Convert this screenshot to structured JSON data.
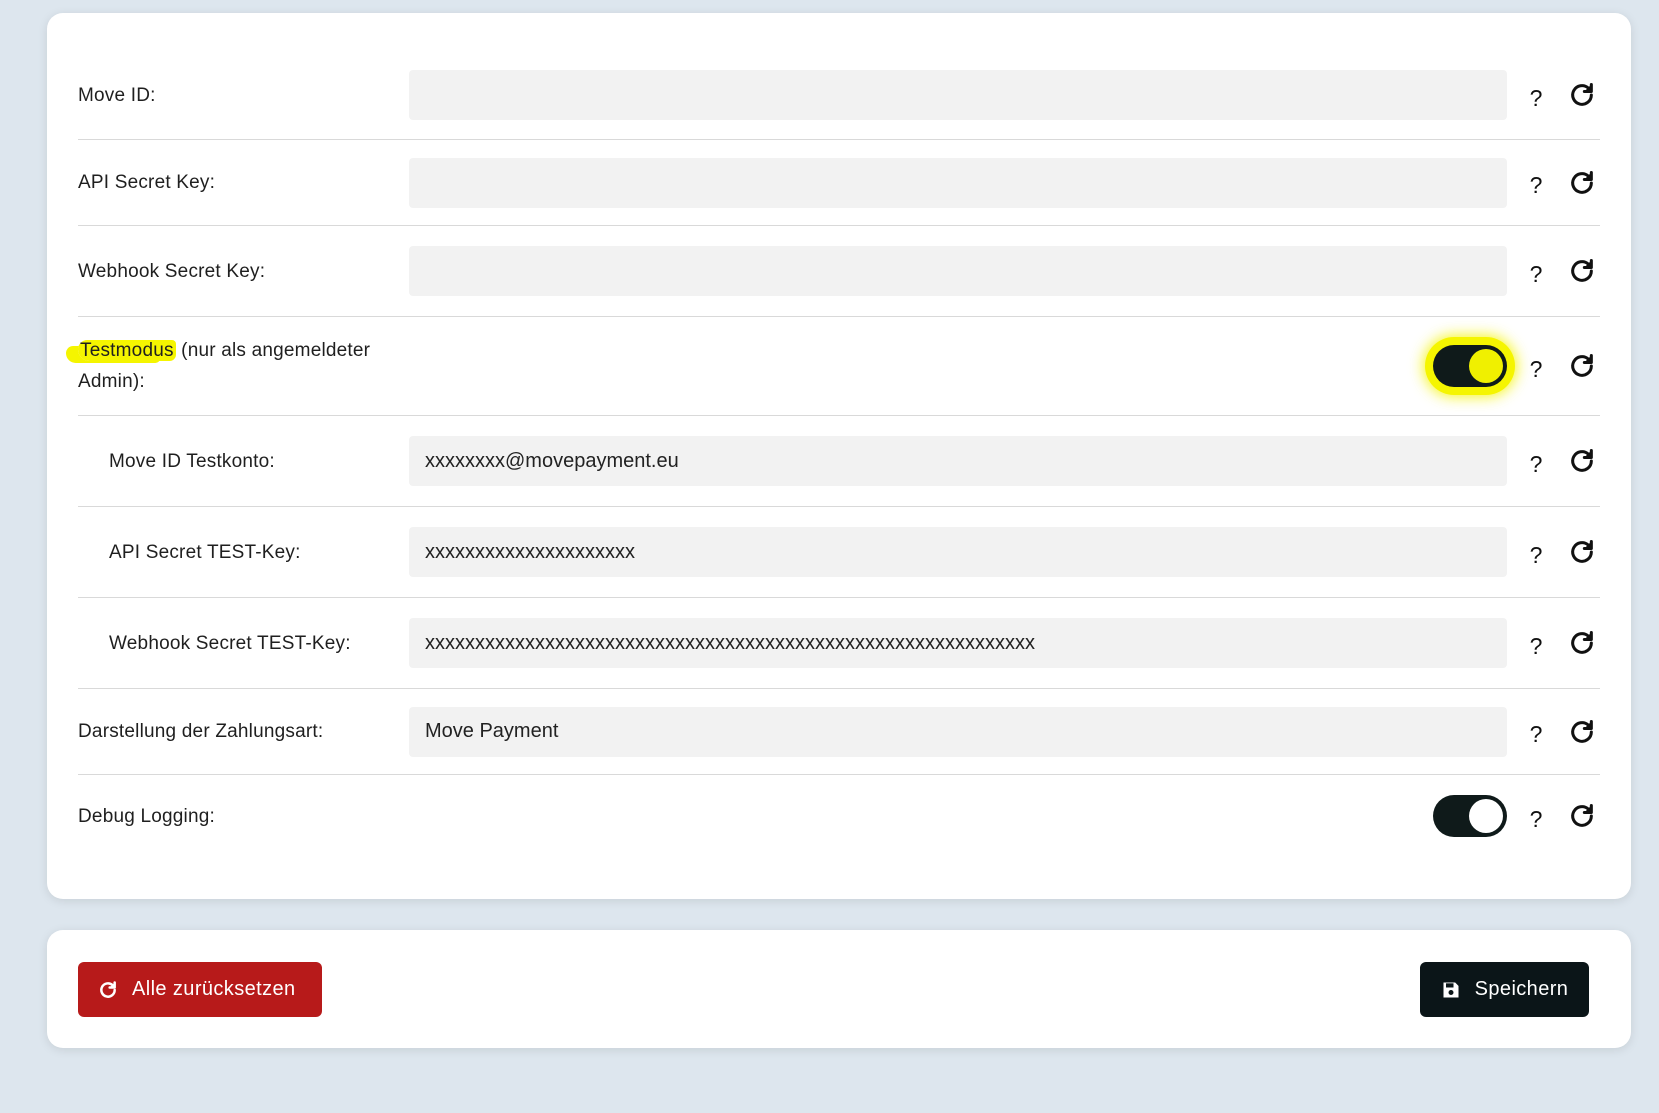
{
  "settings": {
    "rows": [
      {
        "label": "Move ID:",
        "value": ""
      },
      {
        "label": "API Secret Key:",
        "value": ""
      },
      {
        "label": "Webhook Secret Key:",
        "value": ""
      },
      {
        "label_highlight": "Testmodus",
        "label_rest": " (nur als angemeldeter Admin):",
        "toggle_on": true
      },
      {
        "label": "Move ID Testkonto:",
        "value": "xxxxxxxx@movepayment.eu"
      },
      {
        "label": "API Secret TEST-Key:",
        "value": "xxxxxxxxxxxxxxxxxxxxx"
      },
      {
        "label": "Webhook Secret TEST-Key:",
        "value": "xxxxxxxxxxxxxxxxxxxxxxxxxxxxxxxxxxxxxxxxxxxxxxxxxxxxxxxxxxxxx"
      },
      {
        "label": "Darstellung der Zahlungsart:",
        "value": "Move Payment"
      },
      {
        "label": "Debug Logging:",
        "toggle_on": true
      }
    ],
    "help_text": "?"
  },
  "actions": {
    "reset_all_label": "Alle zurücksetzen",
    "save_label": "Speichern"
  },
  "colors": {
    "reset_button": "#b71a1a",
    "save_button": "#0b1518",
    "toggle_track": "#0f1a1a",
    "highlight": "#f5f500"
  },
  "icons": {
    "reset": "redo-icon",
    "save": "floppy-disk-icon"
  }
}
